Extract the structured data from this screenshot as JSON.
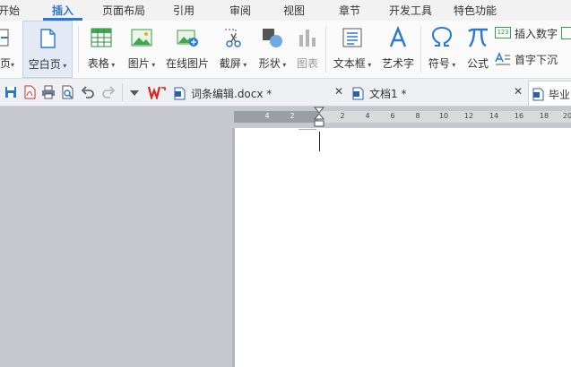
{
  "menu": {
    "tabs": [
      {
        "label": "开始",
        "active": false
      },
      {
        "label": "插入",
        "active": true
      },
      {
        "label": "页面布局",
        "active": false
      },
      {
        "label": "引用",
        "active": false
      },
      {
        "label": "审阅",
        "active": false
      },
      {
        "label": "视图",
        "active": false
      },
      {
        "label": "章节",
        "active": false
      },
      {
        "label": "开发工具",
        "active": false
      },
      {
        "label": "特色功能",
        "active": false
      }
    ]
  },
  "ribbon": {
    "page": "页",
    "blank_page": "空白页",
    "table": "表格",
    "picture": "图片",
    "online_picture": "在线图片",
    "screenshot": "截屏",
    "shapes": "形状",
    "chart": "图表",
    "textbox": "文本框",
    "wordart": "艺术字",
    "symbol": "符号",
    "formula": "公式",
    "insert_number": "插入数字",
    "number_badge": "123",
    "drop_cap": "首字下沉"
  },
  "doc_tabs": [
    {
      "label": "词条编辑.docx *"
    },
    {
      "label": "文档1 *"
    },
    {
      "label": "毕业"
    }
  ],
  "ruler": {
    "ticks": [
      "4",
      "2",
      "2",
      "4",
      "6",
      "8",
      "10",
      "12",
      "14",
      "16",
      "18",
      "20"
    ]
  },
  "colors": {
    "accent": "#2b78d0",
    "wps_red": "#d9251c",
    "workspace": "#c6c8cd",
    "page": "#ffffff"
  }
}
